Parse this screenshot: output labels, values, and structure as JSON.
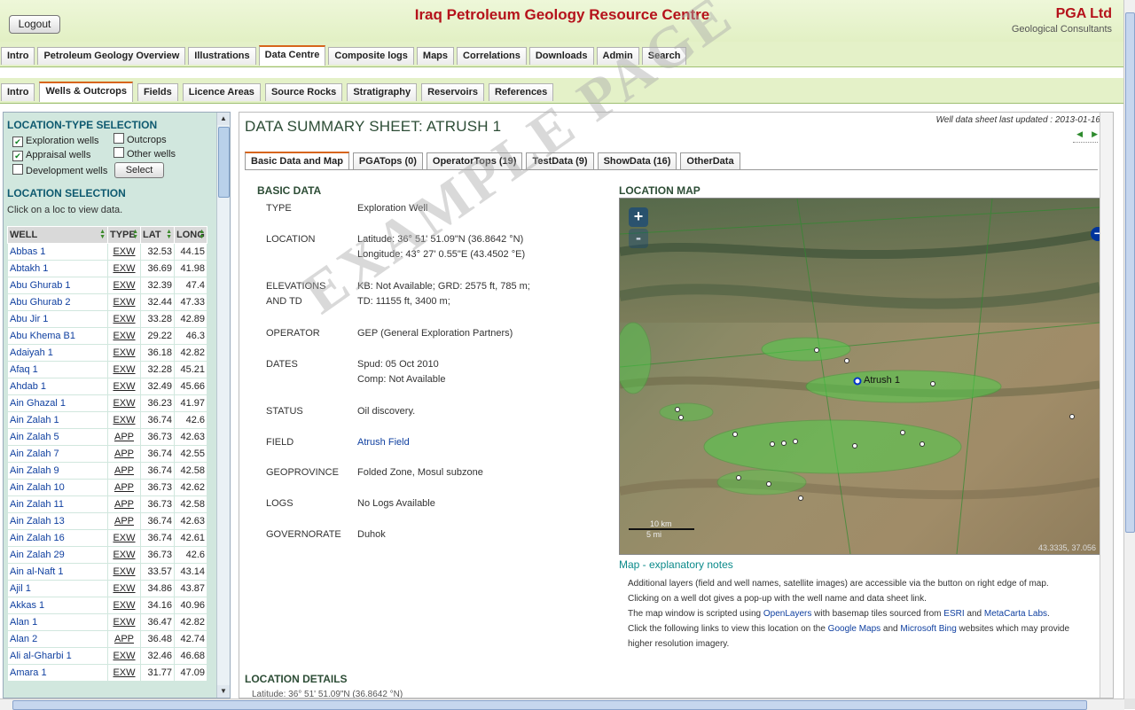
{
  "header": {
    "logout_label": "Logout",
    "site_title": "Iraq Petroleum Geology Resource Centre",
    "org_name": "PGA Ltd",
    "org_subtitle": "Geological Consultants"
  },
  "main_tabs": [
    "Intro",
    "Petroleum Geology Overview",
    "Illustrations",
    "Data Centre",
    "Composite logs",
    "Maps",
    "Correlations",
    "Downloads",
    "Admin",
    "Search"
  ],
  "main_tab_active": "Data Centre",
  "sub_tabs": [
    "Intro",
    "Wells & Outcrops",
    "Fields",
    "Licence Areas",
    "Source Rocks",
    "Stratigraphy",
    "Reservoirs",
    "References"
  ],
  "sub_tab_active": "Wells & Outcrops",
  "sidebar": {
    "loc_type_title": "LOCATION-TYPE SELECTION",
    "checkboxes": {
      "exploration": {
        "label": "Exploration wells",
        "checked": true
      },
      "outcrops": {
        "label": "Outcrops",
        "checked": false
      },
      "appraisal": {
        "label": "Appraisal wells",
        "checked": true
      },
      "other": {
        "label": "Other wells",
        "checked": false
      },
      "development": {
        "label": "Development wells",
        "checked": false
      }
    },
    "select_label": "Select",
    "loc_selection_title": "LOCATION SELECTION",
    "hint": "Click on a loc to view data.",
    "columns": [
      "WELL",
      "TYPE",
      "LAT",
      "LONG"
    ],
    "wells": [
      [
        "Abbas 1",
        "EXW",
        "32.53",
        "44.15"
      ],
      [
        "Abtakh 1",
        "EXW",
        "36.69",
        "41.98"
      ],
      [
        "Abu Ghurab 1",
        "EXW",
        "32.39",
        "47.4"
      ],
      [
        "Abu Ghurab 2",
        "EXW",
        "32.44",
        "47.33"
      ],
      [
        "Abu Jir 1",
        "EXW",
        "33.28",
        "42.89"
      ],
      [
        "Abu Khema B1",
        "EXW",
        "29.22",
        "46.3"
      ],
      [
        "Adaiyah 1",
        "EXW",
        "36.18",
        "42.82"
      ],
      [
        "Afaq 1",
        "EXW",
        "32.28",
        "45.21"
      ],
      [
        "Ahdab 1",
        "EXW",
        "32.49",
        "45.66"
      ],
      [
        "Ain Ghazal 1",
        "EXW",
        "36.23",
        "41.97"
      ],
      [
        "Ain Zalah 1",
        "EXW",
        "36.74",
        "42.6"
      ],
      [
        "Ain Zalah 5",
        "APP",
        "36.73",
        "42.63"
      ],
      [
        "Ain Zalah 7",
        "APP",
        "36.74",
        "42.55"
      ],
      [
        "Ain Zalah 9",
        "APP",
        "36.74",
        "42.58"
      ],
      [
        "Ain Zalah 10",
        "APP",
        "36.73",
        "42.62"
      ],
      [
        "Ain Zalah 11",
        "APP",
        "36.73",
        "42.58"
      ],
      [
        "Ain Zalah 13",
        "APP",
        "36.74",
        "42.63"
      ],
      [
        "Ain Zalah 16",
        "EXW",
        "36.74",
        "42.61"
      ],
      [
        "Ain Zalah 29",
        "EXW",
        "36.73",
        "42.6"
      ],
      [
        "Ain al-Naft 1",
        "EXW",
        "33.57",
        "43.14"
      ],
      [
        "Ajil 1",
        "EXW",
        "34.86",
        "43.87"
      ],
      [
        "Akkas 1",
        "EXW",
        "34.16",
        "40.96"
      ],
      [
        "Alan 1",
        "EXW",
        "36.47",
        "42.82"
      ],
      [
        "Alan 2",
        "APP",
        "36.48",
        "42.74"
      ],
      [
        "Ali al-Gharbi 1",
        "EXW",
        "32.46",
        "46.68"
      ],
      [
        "Amara 1",
        "EXW",
        "31.77",
        "47.09"
      ]
    ]
  },
  "content": {
    "title": "DATA SUMMARY SHEET: ATRUSH 1",
    "last_updated": "Well data sheet last updated : 2013-01-16",
    "tabs": [
      "Basic Data and Map",
      "PGATops (0)",
      "OperatorTops (19)",
      "TestData (9)",
      "ShowData (16)",
      "OtherData"
    ],
    "active_tab": "Basic Data and Map",
    "basic_data_title": "BASIC DATA",
    "basic": {
      "type_label": "TYPE",
      "type_value": "Exploration Well",
      "location_label": "LOCATION",
      "lat_value": "Latitude: 36° 51' 51.09\"N (36.8642 °N)",
      "lon_value": "Longitude: 43° 27' 0.55\"E (43.4502 °E)",
      "elev_label1": "ELEVATIONS",
      "elev_label2": "AND TD",
      "elev_value": "KB: Not Available; GRD: 2575 ft, 785 m;",
      "td_value": "TD: 11155 ft, 3400 m;",
      "operator_label": "OPERATOR",
      "operator_value": "GEP (General Exploration Partners)",
      "dates_label": "DATES",
      "spud_value": "Spud: 05 Oct 2010",
      "comp_value": "Comp: Not Available",
      "status_label": "STATUS",
      "status_value": "Oil discovery.",
      "field_label": "FIELD",
      "field_value": "Atrush Field",
      "geoprovince_label": "GEOPROVINCE",
      "geoprovince_value": "Folded Zone, Mosul subzone",
      "logs_label": "LOGS",
      "logs_value": "No Logs Available",
      "governorate_label": "GOVERNORATE",
      "governorate_value": "Duhok"
    },
    "map_title": "LOCATION MAP",
    "map": {
      "zoom_in": "+",
      "zoom_out": "-",
      "well_label": "Atrush 1",
      "scale_top": "10 km",
      "scale_bottom": "5 mi",
      "coords": "43.3335, 37.056"
    },
    "map_notes_link": "Map - explanatory notes",
    "notes": {
      "l1": "Additional layers (field and well names, satellite images) are accessible via the button on right edge of map.",
      "l2": "Clicking on a well dot gives a pop-up with the well name and data sheet link.",
      "l3a": "The map window is scripted using ",
      "l3_openlayers": "OpenLayers",
      "l3b": " with basemap tiles sourced from ",
      "l3_esri": "ESRI",
      "l3c": " and ",
      "l3_metacarta": "MetaCarta Labs",
      "l3d": ".",
      "l4a": "Click the following links to view this location on the ",
      "l4_gmaps": "Google Maps",
      "l4b": " and ",
      "l4_bing": "Microsoft Bing",
      "l4c": " websites which may provide",
      "l5": "higher resolution imagery."
    },
    "loc_details_title": "LOCATION DETAILS",
    "loc_details_cut": "Latitude: 36° 51' 51.09\"N (36.8642 °N)"
  },
  "watermark": "EXAMPLE PAGE",
  "colors": {
    "title_red": "#b5121b",
    "header_green": "#e4f1c8",
    "sidebar_bg": "#d1e7de",
    "tab_active_accent": "#d7651c"
  }
}
